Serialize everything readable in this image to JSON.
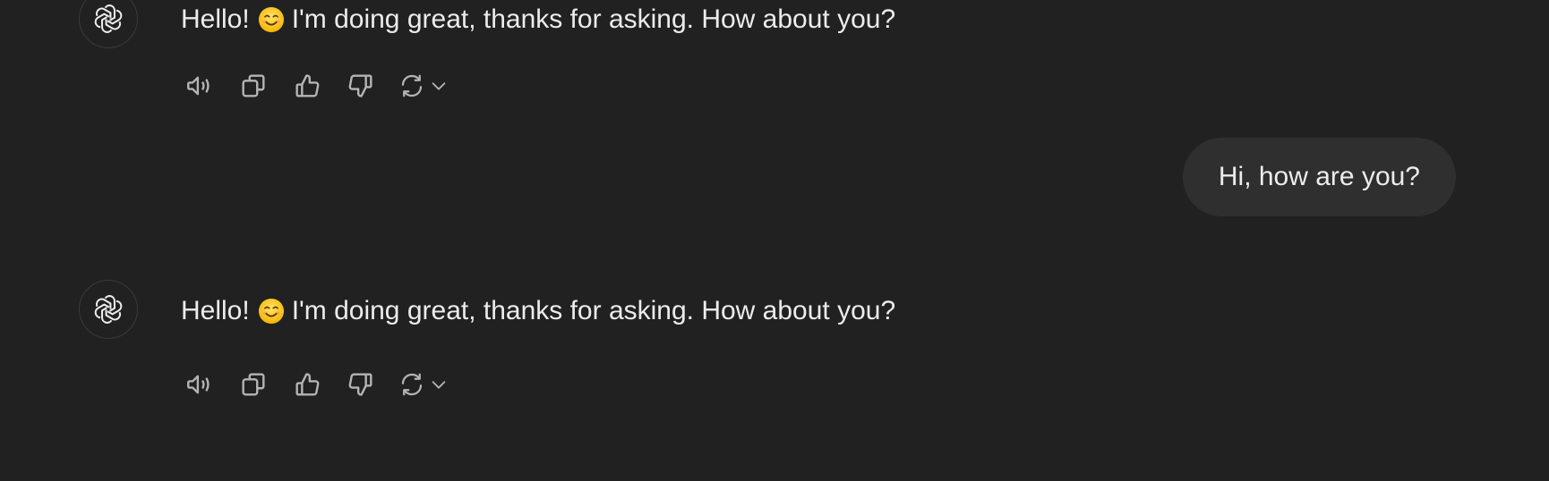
{
  "messages": [
    {
      "role": "assistant",
      "text_before": "Hello!",
      "emoji": "smiling-face-emoji",
      "text_after": "I'm doing great, thanks for asking. How about you?"
    },
    {
      "role": "user",
      "text": "Hi, how are you?"
    },
    {
      "role": "assistant",
      "text_before": "Hello!",
      "emoji": "smiling-face-emoji",
      "text_after": "I'm doing great, thanks for asking. How about you?"
    }
  ],
  "actions": [
    "read-aloud-icon",
    "copy-icon",
    "thumbs-up-icon",
    "thumbs-down-icon",
    "regenerate-icon"
  ],
  "colors": {
    "background": "#212121",
    "user_bubble": "#2f2f2f",
    "text": "#ececec",
    "icon": "#b4b4b4"
  }
}
